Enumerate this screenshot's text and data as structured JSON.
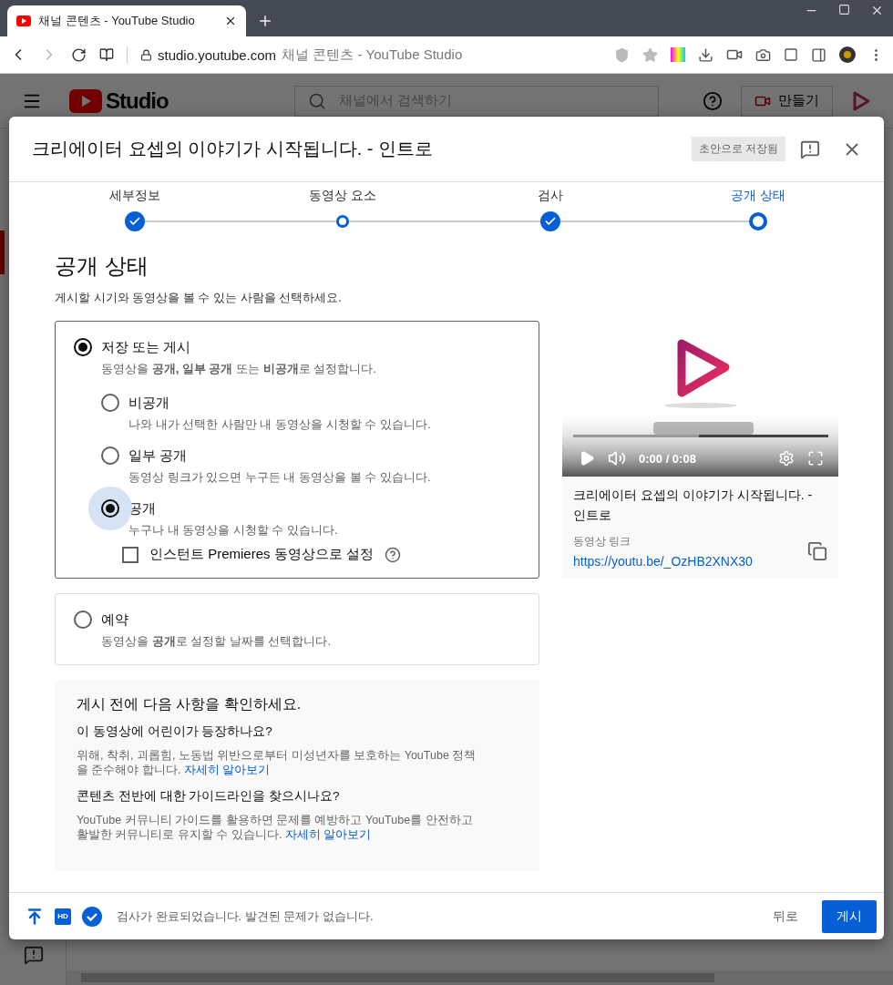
{
  "browser": {
    "tab": {
      "title": "채널 콘텐츠 - YouTube Studio"
    },
    "address": {
      "host": "studio.youtube.com",
      "page_title": "채널 콘텐츠 - YouTube Studio"
    }
  },
  "studio": {
    "logo": "Studio",
    "search": {
      "placeholder": "채널에서 검색하기"
    },
    "create_button": "만들기"
  },
  "dialog": {
    "title": "크리에이터 요셉의 이야기가 시작됩니다. - 인트로",
    "draft_badge": "초안으로 저장됨",
    "steps": [
      {
        "label": "세부정보",
        "kind": "done",
        "selected": false
      },
      {
        "label": "동영상 요소",
        "kind": "open",
        "selected": false
      },
      {
        "label": "검사",
        "kind": "done",
        "selected": false
      },
      {
        "label": "공개 상태",
        "kind": "open",
        "selected": true
      }
    ],
    "heading": "공개 상태",
    "subtitle": "게시할 시기와 동영상을 볼 수 있는 사람을 선택하세요.",
    "options": [
      {
        "label": "저장 또는 게시",
        "description": "동영상을 **공개,** **일부 공개** 또는 **비공개**로 설정합니다.",
        "selected": true,
        "children": [
          {
            "label": "비공개",
            "description": "나와 내가 선택한 사람만 내 동영상을 시청할 수 있습니다.",
            "selected": false,
            "focused": false
          },
          {
            "label": "일부 공개",
            "description": "동영상 링크가 있으면 누구든 내 동영상을 볼 수 있습니다.",
            "selected": false,
            "focused": false
          },
          {
            "label": "공개",
            "description": "누구나 내 동영상을 시청할 수 있습니다.",
            "selected": true,
            "focused": true
          }
        ],
        "checkbox": {
          "label": "인스턴트 Premieres 동영상으로 설정",
          "checked": false
        }
      },
      {
        "label": "예약",
        "description": "동영상을 **공개**로 설정할 날짜를 선택합니다.",
        "selected": false
      }
    ],
    "checklist": {
      "title": "게시 전에 다음 사항을 확인하세요.",
      "sections": [
        {
          "question": "이 동영상에 어린이가 등장하나요?",
          "text": "위해, 착취, 괴롭힘, 노동법 위반으로부터 미성년자를 보호하는 YouTube 정책을 준수해야 합니다.",
          "link": "자세히 알아보기"
        },
        {
          "question": "콘텐츠 전반에 대한 가이드라인을 찾으시나요?",
          "text": "YouTube 커뮤니티 가이드를 활용하면 문제를 예방하고 YouTube를 안전하고 활발한 커뮤니티로 유지할 수 있습니다.",
          "link": "자세히 알아보기"
        }
      ]
    },
    "preview": {
      "time": "0:00 / 0:08",
      "title": "크리에이터 요셉의 이야기가 시작됩니다. - 인트로",
      "link_label": "동영상 링크",
      "link": "https://youtu.be/_OzHB2XNX30"
    },
    "footer": {
      "hd_badge": "HD",
      "status": "검사가 완료되었습니다. 발견된 문제가 없습니다.",
      "back_button": "뒤로",
      "publish_button": "게시"
    }
  }
}
